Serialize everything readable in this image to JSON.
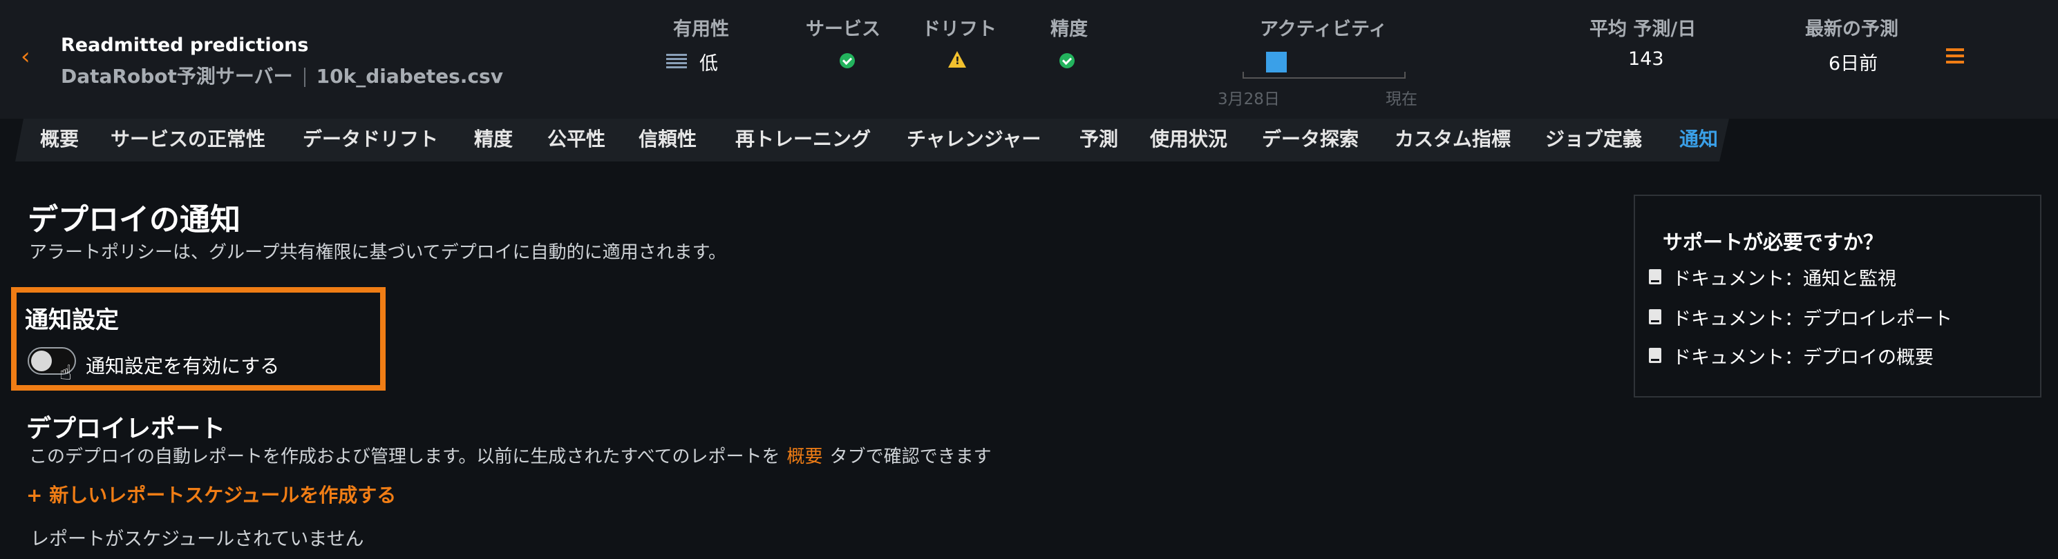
{
  "header": {
    "back_icon": "chevron-left-icon",
    "title": "Readmitted predictions",
    "server": "DataRobot予測サーバー",
    "dataset": "10k_diabetes.csv",
    "metrics": {
      "usefulness_label": "有用性",
      "usefulness_value": "低",
      "service_label": "サービス",
      "drift_label": "ドリフト",
      "accuracy_label": "精度",
      "activity_label": "アクティビティ",
      "activity_start": "3月28日",
      "activity_end": "現在",
      "avg_label": "平均 予測/日",
      "avg_value": "143",
      "latest_label": "最新の予測",
      "latest_value": "6日前"
    },
    "status_colors": {
      "ok": "#23b35d",
      "warn": "#f2c12e"
    },
    "menu_icon": "hamburger-menu-icon"
  },
  "tabs": [
    "概要",
    "サービスの正常性",
    "データドリフト",
    "精度",
    "公平性",
    "信頼性",
    "再トレーニング",
    "チャレンジャー",
    "予測",
    "使用状況",
    "データ探索",
    "カスタム指標",
    "ジョブ定義",
    "通知"
  ],
  "active_tab": "通知",
  "main": {
    "title": "デプロイの通知",
    "subtitle": "アラートポリシーは、グループ共有権限に基づいてデプロイに自動的に適用されます。",
    "notifications": {
      "title": "通知設定",
      "toggle_label": "通知設定を有効にする",
      "toggle_on": false
    },
    "reports": {
      "title": "デプロイレポート",
      "desc_before": "このデプロイの自動レポートを作成および管理します。以前に生成されたすべてのレポートを",
      "desc_link": "概要",
      "desc_after": "タブで確認できます",
      "create_label": "+ 新しいレポートスケジュールを作成する",
      "empty_text": "レポートがスケジュールされていません"
    }
  },
  "help": {
    "title": "サポートが必要ですか？",
    "links": [
      "ドキュメント：通知と監視",
      "ドキュメント：デプロイレポート",
      "ドキュメント：デプロイの概要"
    ]
  },
  "accent": "#f07d15",
  "link_blue": "#3aa0e8"
}
